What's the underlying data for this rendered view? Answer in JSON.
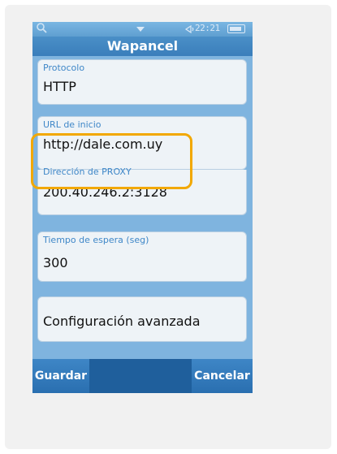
{
  "status_bar": {
    "time": "22:21",
    "icons": [
      "search-icon",
      "chevron-down-icon",
      "signal-icon",
      "battery-icon"
    ]
  },
  "title": "Wapancel",
  "fields": [
    {
      "label": "Protocolo",
      "value": "HTTP"
    },
    {
      "label": "URL de inicio",
      "value": "http://dale.com.uy"
    },
    {
      "label": "Dirección de PROXY",
      "value": "200.40.246.2:3128"
    },
    {
      "label": "Tiempo de espera (seg)",
      "value": "300"
    },
    {
      "label": "",
      "value": "Configuración avanzada"
    }
  ],
  "buttons": {
    "save": "Guardar",
    "cancel": "Cancelar"
  },
  "colors": {
    "highlight": "#f2a800",
    "label_blue": "#3f87c8",
    "bottom_bar": "#1f5f9c"
  }
}
